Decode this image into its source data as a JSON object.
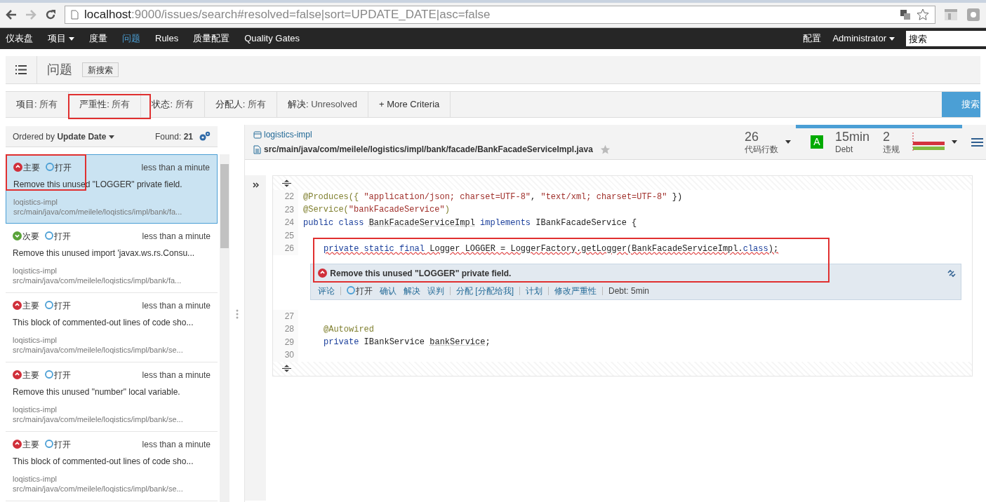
{
  "browser": {
    "url_host": "localhost",
    "url_rest": ":9000/issues/search#resolved=false|sort=UPDATE_DATE|asc=false"
  },
  "nav": {
    "left": [
      {
        "label": "仪表盘",
        "dropdown": false,
        "selected": false
      },
      {
        "label": "项目",
        "dropdown": true,
        "selected": false
      },
      {
        "label": "度量",
        "dropdown": false,
        "selected": false
      },
      {
        "label": "问题",
        "dropdown": false,
        "selected": true
      },
      {
        "label": "Rules",
        "dropdown": false,
        "selected": false
      },
      {
        "label": "质量配置",
        "dropdown": false,
        "selected": false
      },
      {
        "label": "Quality Gates",
        "dropdown": false,
        "selected": false
      }
    ],
    "right": [
      {
        "label": "配置",
        "dropdown": false
      },
      {
        "label": "Administrator",
        "dropdown": true
      }
    ],
    "search_placeholder": "搜索"
  },
  "page_header": {
    "title": "问题",
    "button": "新搜索"
  },
  "filters": [
    {
      "label": "项目:",
      "value": "所有"
    },
    {
      "label": "严重性:",
      "value": "所有"
    },
    {
      "label": "状态:",
      "value": "所有"
    },
    {
      "label": "分配人:",
      "value": "所有"
    },
    {
      "label": "解决:",
      "value": "Unresolved"
    }
  ],
  "more_criteria": "+ More Criteria",
  "search_button": "搜索",
  "issue_list": {
    "order_label": "Ordered by",
    "order_value": "Update Date",
    "found_label": "Found:",
    "found_value": "21",
    "items": [
      {
        "severity": "主要",
        "kind": "major",
        "status": "打开",
        "time": "less than a minute",
        "message": "Remove this unused \"LOGGER\" private field.",
        "component": "loqistics-impl",
        "path": "src/main/java/com/meilele/loqistics/impl/bank/fa...",
        "selected": true
      },
      {
        "severity": "次要",
        "kind": "minor",
        "status": "打开",
        "time": "less than a minute",
        "message": "Remove this unused import 'javax.ws.rs.Consu...",
        "component": "loqistics-impl",
        "path": "src/main/java/com/meilele/loqistics/impl/bank/fa...",
        "selected": false
      },
      {
        "severity": "主要",
        "kind": "major",
        "status": "打开",
        "time": "less than a minute",
        "message": "This block of commented-out lines of code sho...",
        "component": "loqistics-impl",
        "path": "src/main/java/com/meilele/loqistics/impl/bank/se...",
        "selected": false
      },
      {
        "severity": "主要",
        "kind": "major",
        "status": "打开",
        "time": "less than a minute",
        "message": "Remove this unused \"number\" local variable.",
        "component": "loqistics-impl",
        "path": "src/main/java/com/meilele/loqistics/impl/bank/se...",
        "selected": false
      },
      {
        "severity": "主要",
        "kind": "major",
        "status": "打开",
        "time": "less than a minute",
        "message": "This block of commented-out lines of code sho...",
        "component": "loqistics-impl",
        "path": "src/main/java/com/meilele/loqistics/impl/bank/se...",
        "selected": false
      }
    ]
  },
  "component": {
    "project": "logistics-impl",
    "path": "src/main/java/com/meilele/logistics/impl/bank/facade/BankFacadeServiceImpl.java",
    "lines_value": "26",
    "lines_label": "代码行数",
    "rating": "A",
    "debt_value": "15min",
    "debt_label": "Debt",
    "violations_value": "2",
    "violations_label": "违规"
  },
  "code": [
    {
      "kind": "line",
      "number": "22",
      "error": false,
      "tokens": [
        {
          "kind": "annotation",
          "text": "@Produces({ "
        },
        {
          "kind": "string",
          "text": "\"application/json; charset=UTF-8\""
        },
        {
          "kind": "plain",
          "text": ", "
        },
        {
          "kind": "string",
          "text": "\"text/xml; charset=UTF-8\""
        },
        {
          "kind": "plain",
          "text": " })"
        }
      ]
    },
    {
      "kind": "line",
      "number": "23",
      "error": false,
      "tokens": [
        {
          "kind": "annotation",
          "text": "@Service("
        },
        {
          "kind": "string",
          "text": "\"bankFacadeService\""
        },
        {
          "kind": "annotation",
          "text": ")"
        }
      ]
    },
    {
      "kind": "line",
      "number": "24",
      "error": false,
      "tokens": [
        {
          "kind": "keyword",
          "text": "public class "
        },
        {
          "kind": "symbol",
          "text": "BankFacadeServiceImpl"
        },
        {
          "kind": "keyword",
          "text": " implements"
        },
        {
          "kind": "plain",
          "text": " IBankFacadeService {"
        }
      ]
    },
    {
      "kind": "line",
      "number": "25"
    },
    {
      "kind": "line",
      "number": "26",
      "error": true,
      "indent": true,
      "tokens": [
        {
          "kind": "keyword",
          "text": "private static final"
        },
        {
          "kind": "plain",
          "text": " Logger LOGGER = LoggerFactory.getLogger(BankFacadeServiceImpl."
        },
        {
          "kind": "keyword",
          "text": "class"
        },
        {
          "kind": "plain",
          "text": ");"
        }
      ]
    },
    {
      "kind": "issue",
      "message": "Remove this unused \"LOGGER\" private field.",
      "groups": [
        [
          {
            "kind": "link",
            "text": "评论"
          }
        ],
        [
          {
            "kind": "status",
            "text": "打开"
          },
          {
            "kind": "link",
            "text": "确认"
          },
          {
            "kind": "link",
            "text": "解决"
          },
          {
            "kind": "link",
            "text": "误判"
          }
        ],
        [
          {
            "kind": "link",
            "text": "分配 [分配给我]"
          }
        ],
        [
          {
            "kind": "link",
            "text": "计划"
          }
        ],
        [
          {
            "kind": "link",
            "text": "修改严重性"
          }
        ]
      ],
      "debt": "Debt: 5min"
    },
    {
      "kind": "line",
      "number": "27"
    },
    {
      "kind": "line",
      "number": "28",
      "error": false,
      "indent": true,
      "tokens": [
        {
          "kind": "annotation",
          "text": "@Autowired"
        }
      ]
    },
    {
      "kind": "line",
      "number": "29",
      "error": false,
      "indent": true,
      "tokens": [
        {
          "kind": "keyword",
          "text": "private"
        },
        {
          "kind": "plain",
          "text": " IBankService "
        },
        {
          "kind": "symbol",
          "text": "bankService"
        },
        {
          "kind": "plain",
          "text": ";"
        }
      ]
    },
    {
      "kind": "line",
      "number": "30"
    }
  ]
}
